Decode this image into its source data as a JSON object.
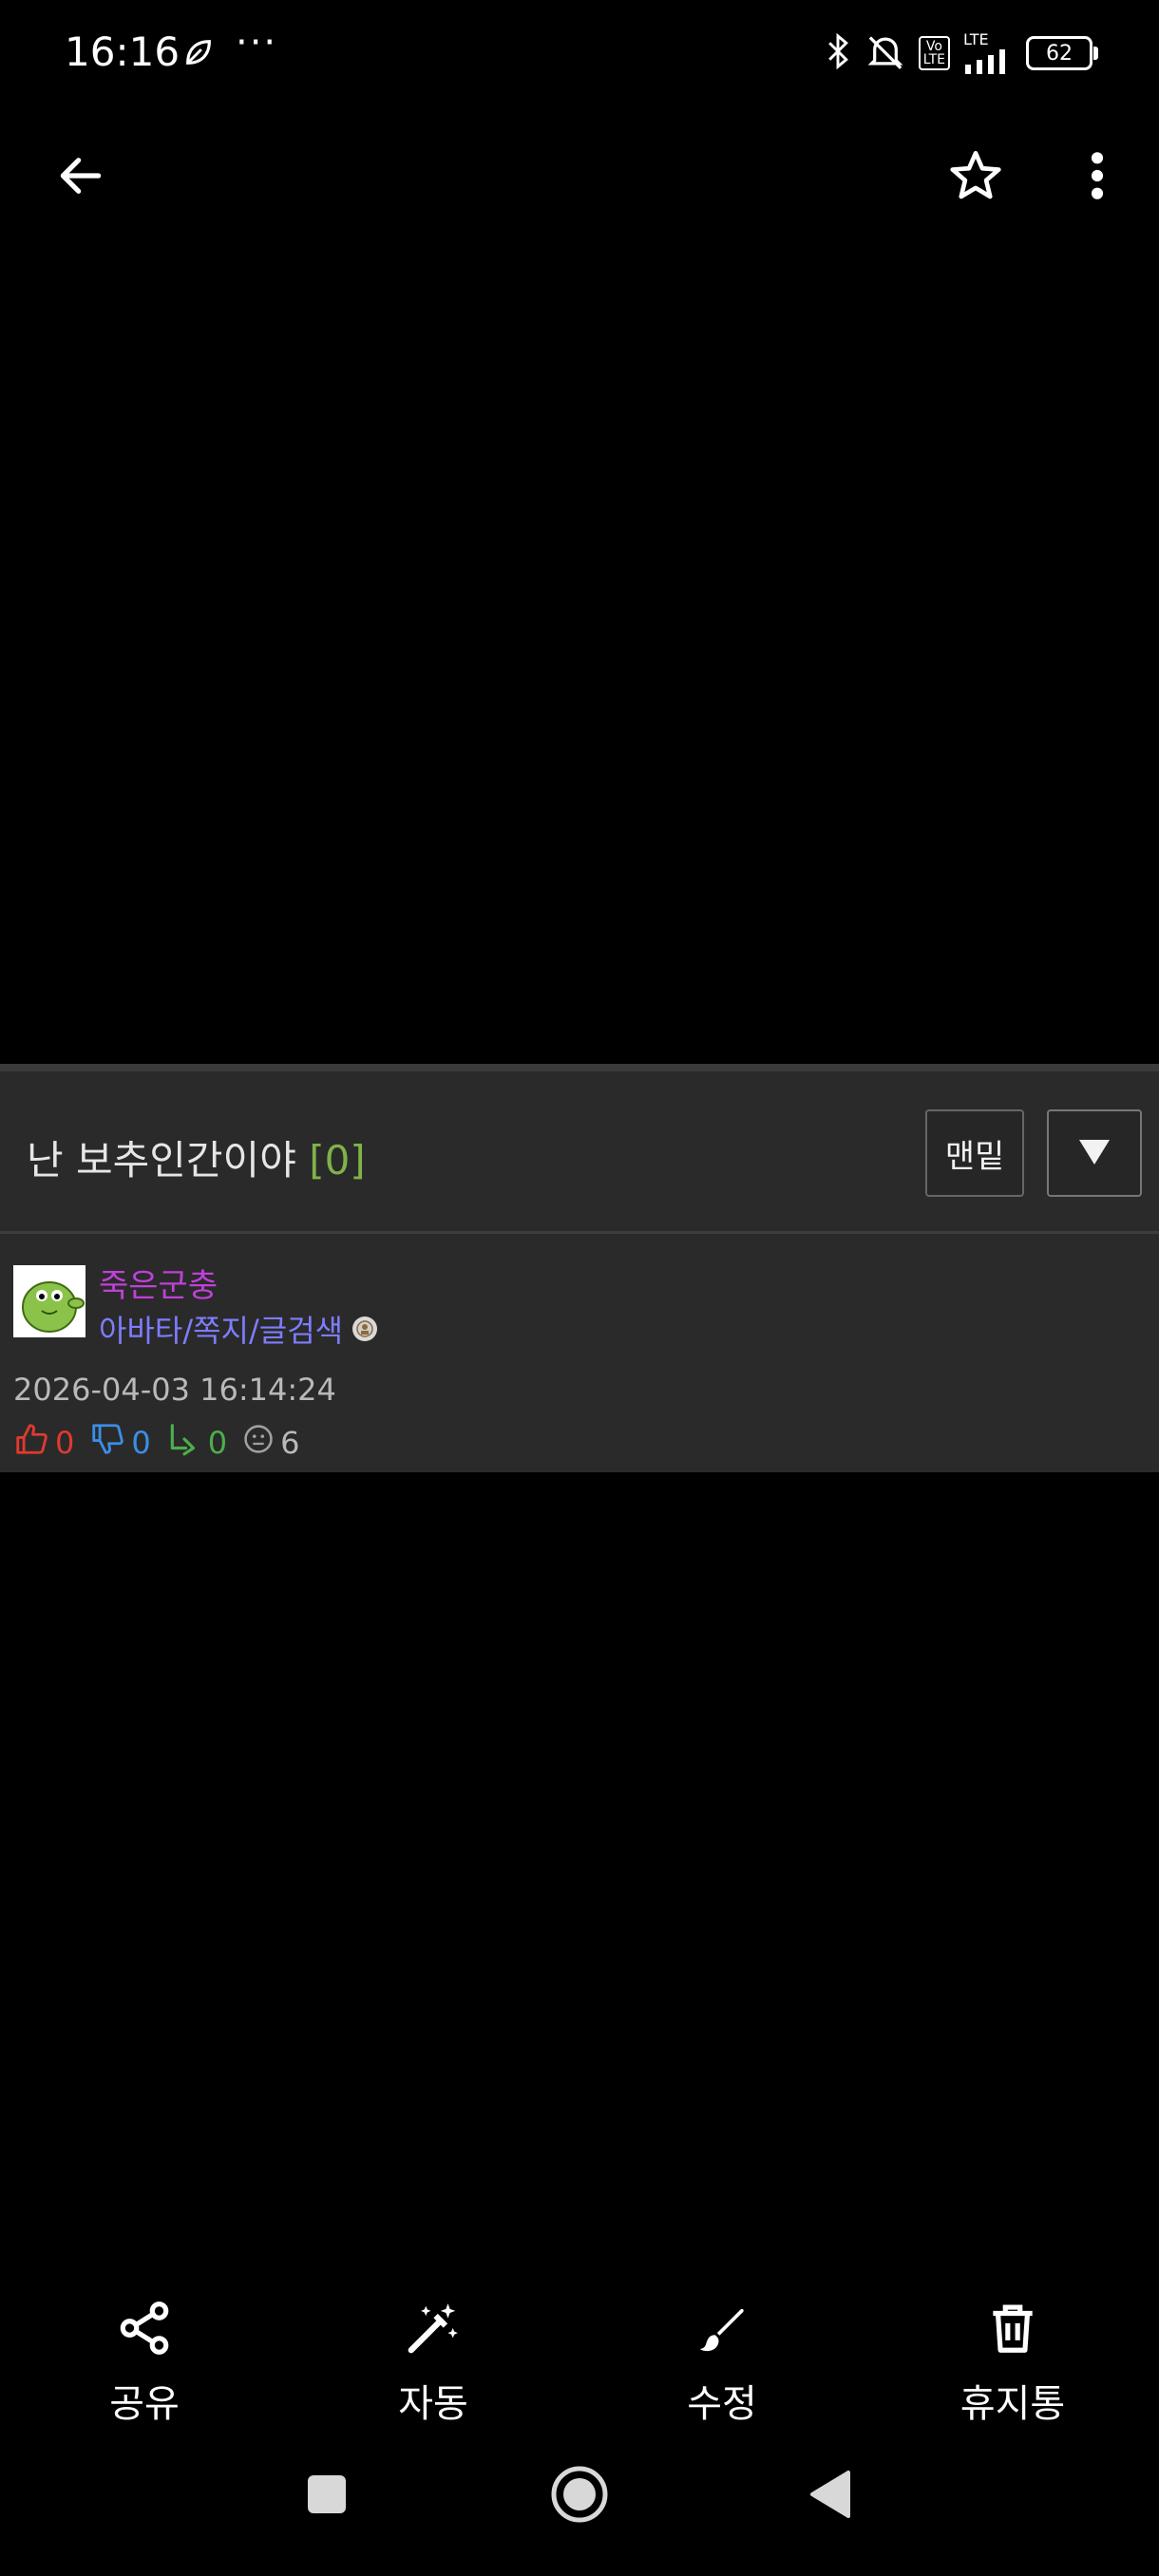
{
  "status_bar": {
    "time": "16:16",
    "more": "···",
    "battery": "62",
    "lte_top": "Vo",
    "lte_bottom": "LTE",
    "lte_signal": "LTE"
  },
  "app_bar": {
    "back_icon": "arrow-left-icon",
    "favorite_icon": "star-outline-icon",
    "menu_icon": "more-vert-icon"
  },
  "post": {
    "title": "난 보추인간이야",
    "comment_count": "[0]",
    "bottom_button": "맨밑",
    "author": "죽은군충",
    "author_links": "아바타/쪽지/글검색",
    "date": "2026-04-03 16:14:24",
    "stats": {
      "likes": "0",
      "dislikes": "0",
      "shares": "0",
      "views": "6"
    },
    "colors": {
      "author": "#c040d8",
      "links": "#7d7dff",
      "like": "#e03a2f",
      "dislike": "#3a8ee6",
      "share": "#4cae4c",
      "count_accent": "#7fb24a"
    }
  },
  "actions": [
    {
      "label": "공유",
      "icon": "share-icon"
    },
    {
      "label": "자동",
      "icon": "magic-wand-icon"
    },
    {
      "label": "수정",
      "icon": "brush-icon"
    },
    {
      "label": "휴지통",
      "icon": "trash-icon"
    }
  ],
  "nav_bar": {
    "recent_icon": "square-icon",
    "home_icon": "circle-icon",
    "back_icon": "triangle-back-icon"
  }
}
